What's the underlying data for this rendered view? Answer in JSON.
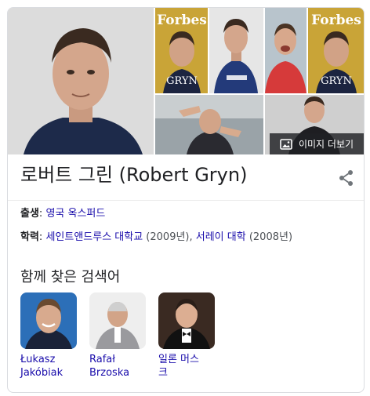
{
  "gallery": {
    "more_images_label": "이미지 더보기",
    "magazine_masthead": "Forbes",
    "magazine_cover_name": "GRYN"
  },
  "entity": {
    "title": "로버트 그린 (Robert Gryn)"
  },
  "facts": {
    "born": {
      "label": "출생",
      "value": "영국 옥스퍼드"
    },
    "education": {
      "label": "학력",
      "school1": "세인트앤드루스 대학교",
      "year1": " (2009년), ",
      "school2": "서레이 대학",
      "year2": " (2008년)"
    }
  },
  "people_also_search": {
    "title": "함께 찾은 검색어",
    "people": [
      {
        "name_line1": "Łukasz",
        "name_line2": "Jakóbiak"
      },
      {
        "name_line1": "Rafał",
        "name_line2": "Brzoska"
      },
      {
        "name_line1": "일론 머스",
        "name_line2": "크"
      }
    ]
  },
  "colors": {
    "link": "#1a0dab",
    "border": "#dadce0",
    "text": "#202124",
    "overlay": "#202124"
  }
}
